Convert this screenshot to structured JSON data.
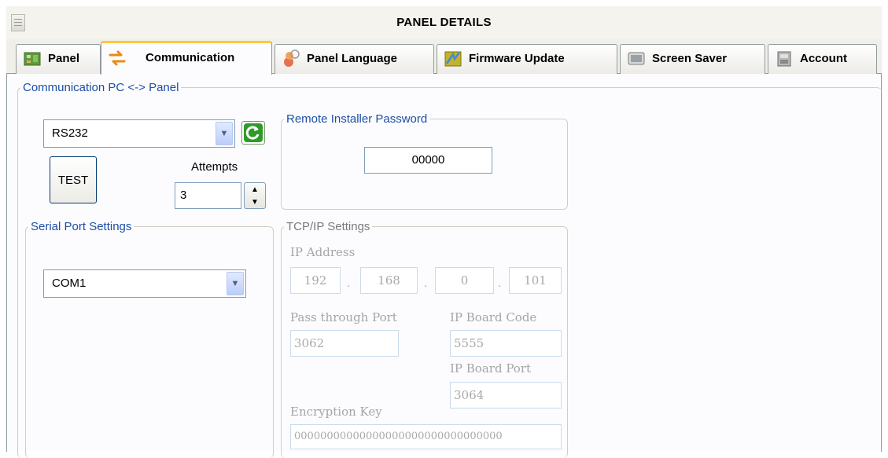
{
  "window": {
    "title": "PANEL DETAILS",
    "icon": "window-icon"
  },
  "tabs": [
    {
      "label": "Panel",
      "icon": "panel-board-icon",
      "active": false
    },
    {
      "label": "Communication",
      "icon": "exchange-arrows-icon",
      "active": true
    },
    {
      "label": "Panel Language",
      "icon": "language-icon",
      "active": false
    },
    {
      "label": "Firmware Update",
      "icon": "firmware-icon",
      "active": false
    },
    {
      "label": "Screen Saver",
      "icon": "screen-saver-icon",
      "active": false
    },
    {
      "label": "Account",
      "icon": "account-icon",
      "active": false
    }
  ],
  "communication": {
    "group_label": "Communication PC <-> Panel",
    "connection_type": "RS232",
    "refresh_icon": "refresh-icon",
    "test_label": "TEST",
    "attempts_label": "Attempts",
    "attempts_value": "3"
  },
  "remote_installer": {
    "group_label": "Remote Installer Password",
    "password": "00000"
  },
  "serial": {
    "group_label": "Serial Port Settings",
    "port": "COM1"
  },
  "tcpip": {
    "group_label": "TCP/IP Settings",
    "ip_label": "IP Address",
    "ip": [
      "192",
      "168",
      "0",
      "101"
    ],
    "ip_separator": ".",
    "pass_through_label": "Pass through Port",
    "pass_through_port": "3062",
    "board_code_label": "IP Board Code",
    "board_code": "5555",
    "board_port_label": "IP Board Port",
    "board_port": "3064",
    "encryption_label": "Encryption Key",
    "encryption_key": "00000000000000000000000000000000"
  },
  "colors": {
    "accent_tab": "#ffc83c",
    "group_label": "#1c4fa3",
    "refresh_green": "#2f9a2a"
  }
}
